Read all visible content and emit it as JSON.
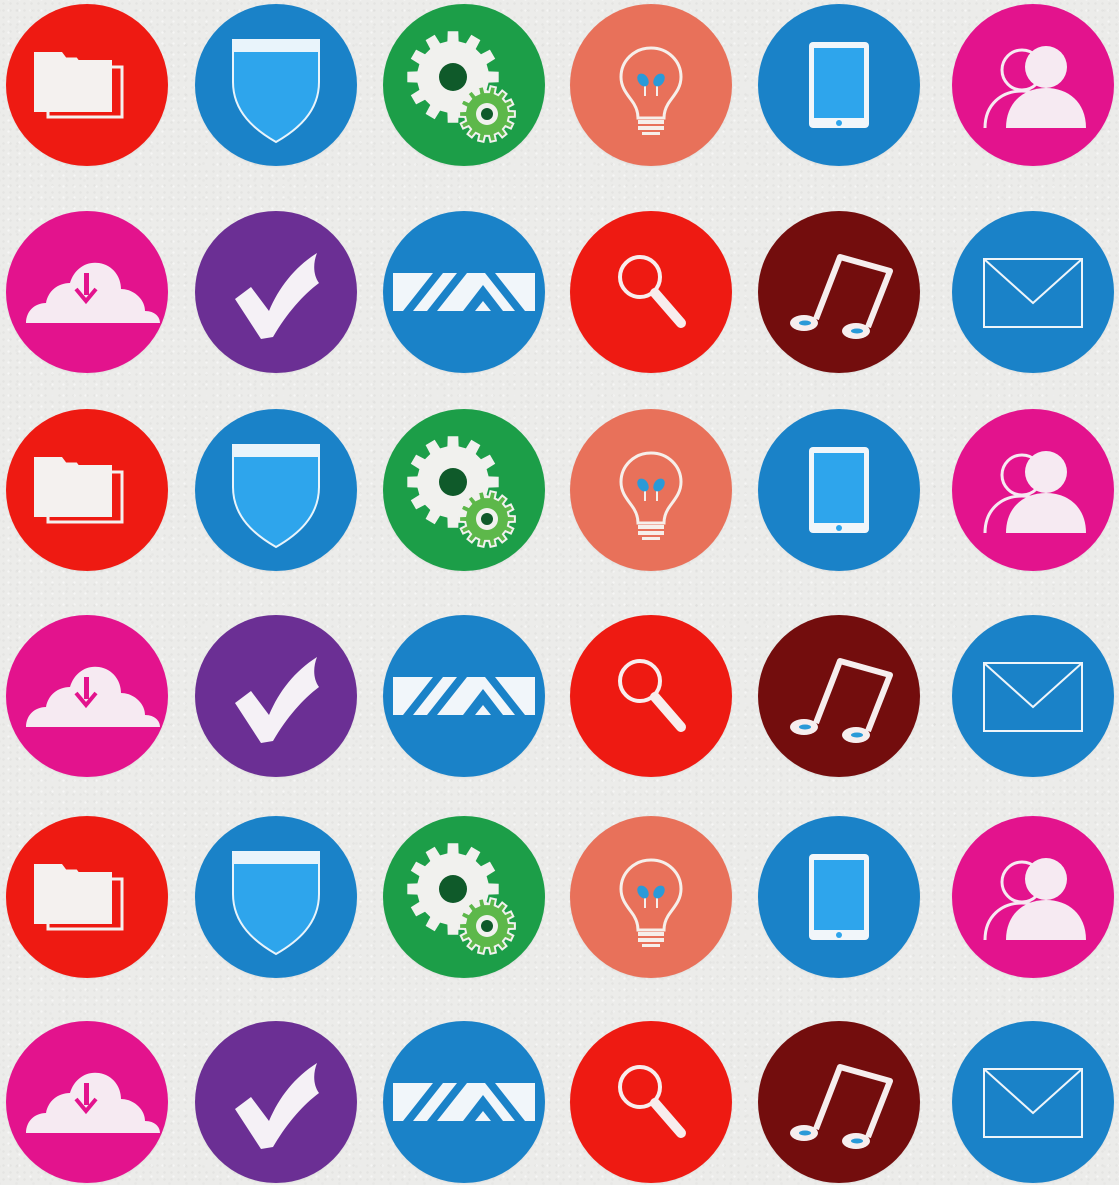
{
  "icon_sequence": [
    {
      "icon": "folders-icon",
      "color": "#ee1a12"
    },
    {
      "icon": "shield-icon",
      "color": "#1a82c8"
    },
    {
      "icon": "gears-icon",
      "color": "#1c9e48"
    },
    {
      "icon": "lightbulb-icon",
      "color": "#e8715a"
    },
    {
      "icon": "tablet-icon",
      "color": "#1a82c8"
    },
    {
      "icon": "users-icon",
      "color": "#e3138d"
    },
    {
      "icon": "cloud-download-icon",
      "color": "#e3138d"
    },
    {
      "icon": "checkmark-icon",
      "color": "#6b2f94"
    },
    {
      "icon": "chevron-pattern-icon",
      "color": "#1a82c8"
    },
    {
      "icon": "search-icon",
      "color": "#ee1a12"
    },
    {
      "icon": "music-note-icon",
      "color": "#730d0d"
    },
    {
      "icon": "mail-icon",
      "color": "#1a82c8"
    }
  ],
  "grid": {
    "columns": 6,
    "rows": 6
  }
}
